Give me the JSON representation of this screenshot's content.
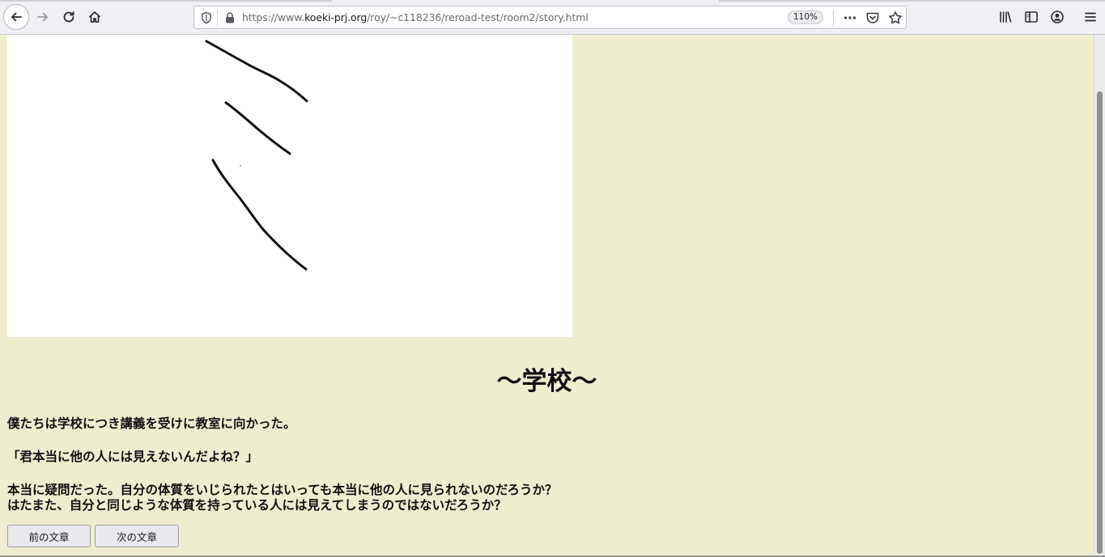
{
  "browser": {
    "url_prefix": "https://www.",
    "url_domain": "koeki-prj.org",
    "url_path": "/roy/~c118236/reroad-test/room2/story.html",
    "zoom_level": "110%",
    "icons": {
      "back": "back-arrow-icon",
      "forward": "forward-arrow-icon",
      "reload": "reload-icon",
      "home": "home-icon",
      "tracking": "shield-icon",
      "lock": "lock-icon",
      "more": "more-actions-icon",
      "pocket": "pocket-icon",
      "bookmark": "bookmark-star-icon",
      "library": "library-icon",
      "sidebar": "sidebar-icon",
      "account": "account-icon",
      "menu": "hamburger-menu-icon"
    }
  },
  "page": {
    "background_color": "#eeedd0",
    "title": "～学校～",
    "lines": [
      "僕たちは学校につき講義を受けに教室に向かった。",
      "「君本当に他の人には見えないんだよね？」",
      "本当に疑問だった。自分の体質をいじられたとはいっても本当に他の人に見られないのだろうか？",
      "はたまた、自分と同じような体質を持っている人には見えてしまうのではないだろうか？"
    ],
    "buttons": {
      "prev_label": "前の文章",
      "next_label": "次の文章"
    }
  }
}
